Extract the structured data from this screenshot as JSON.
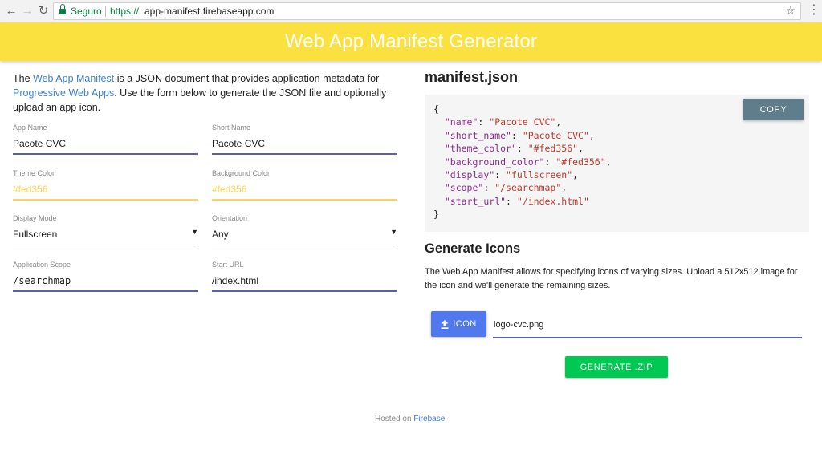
{
  "browser": {
    "back_icon": "arrow-left-icon",
    "forward_icon": "arrow-right-icon",
    "reload_icon": "reload-icon",
    "secure_label": "Seguro",
    "url_scheme": "https://",
    "url_host": "app-manifest.firebaseapp.com",
    "bookmark_icon": "star-icon",
    "menu_icon": "kebab-menu-icon"
  },
  "header": {
    "title": "Web App Manifest Generator",
    "background_color": "#fbe13f"
  },
  "intro": {
    "text_1": "The ",
    "link_manifest": "Web App Manifest",
    "text_2": " is a JSON document that provides application metadata for ",
    "link_pwa": "Progressive Web Apps",
    "text_3": ". Use the form below to generate the JSON file and optionally upload an app icon."
  },
  "form": {
    "app_name": {
      "label": "App Name",
      "value": "Pacote CVC"
    },
    "short_name": {
      "label": "Short Name",
      "value": "Pacote CVC"
    },
    "theme_color": {
      "label": "Theme Color",
      "value": "#fed356"
    },
    "background_color": {
      "label": "Background Color",
      "value": "#fed356"
    },
    "display_mode": {
      "label": "Display Mode",
      "value": "Fullscreen"
    },
    "orientation": {
      "label": "Orientation",
      "value": "Any"
    },
    "scope": {
      "label": "Application Scope",
      "value": "/searchmap"
    },
    "start_url": {
      "label": "Start URL",
      "value": "/index.html"
    }
  },
  "manifest": {
    "heading": "manifest.json",
    "copy_label": "COPY",
    "open_brace": "{",
    "close_brace": "}",
    "entries": [
      {
        "key": "\"name\"",
        "value": "\"Pacote CVC\""
      },
      {
        "key": "\"short_name\"",
        "value": "\"Pacote CVC\""
      },
      {
        "key": "\"theme_color\"",
        "value": "\"#fed356\""
      },
      {
        "key": "\"background_color\"",
        "value": "\"#fed356\""
      },
      {
        "key": "\"display\"",
        "value": "\"fullscreen\""
      },
      {
        "key": "\"scope\"",
        "value": "\"/searchmap\""
      },
      {
        "key": "\"start_url\"",
        "value": "\"/index.html\""
      }
    ]
  },
  "icons": {
    "heading": "Generate Icons",
    "description": "The Web App Manifest allows for specifying icons of varying sizes. Upload a 512x512 image for the icon and we'll generate the remaining sizes.",
    "upload_label": "ICON",
    "upload_icon": "upload-icon",
    "file_name": "logo-cvc.png",
    "generate_label": "GENERATE .ZIP"
  },
  "footer": {
    "text": "Hosted on ",
    "link": "Firebase",
    "suffix": "."
  }
}
